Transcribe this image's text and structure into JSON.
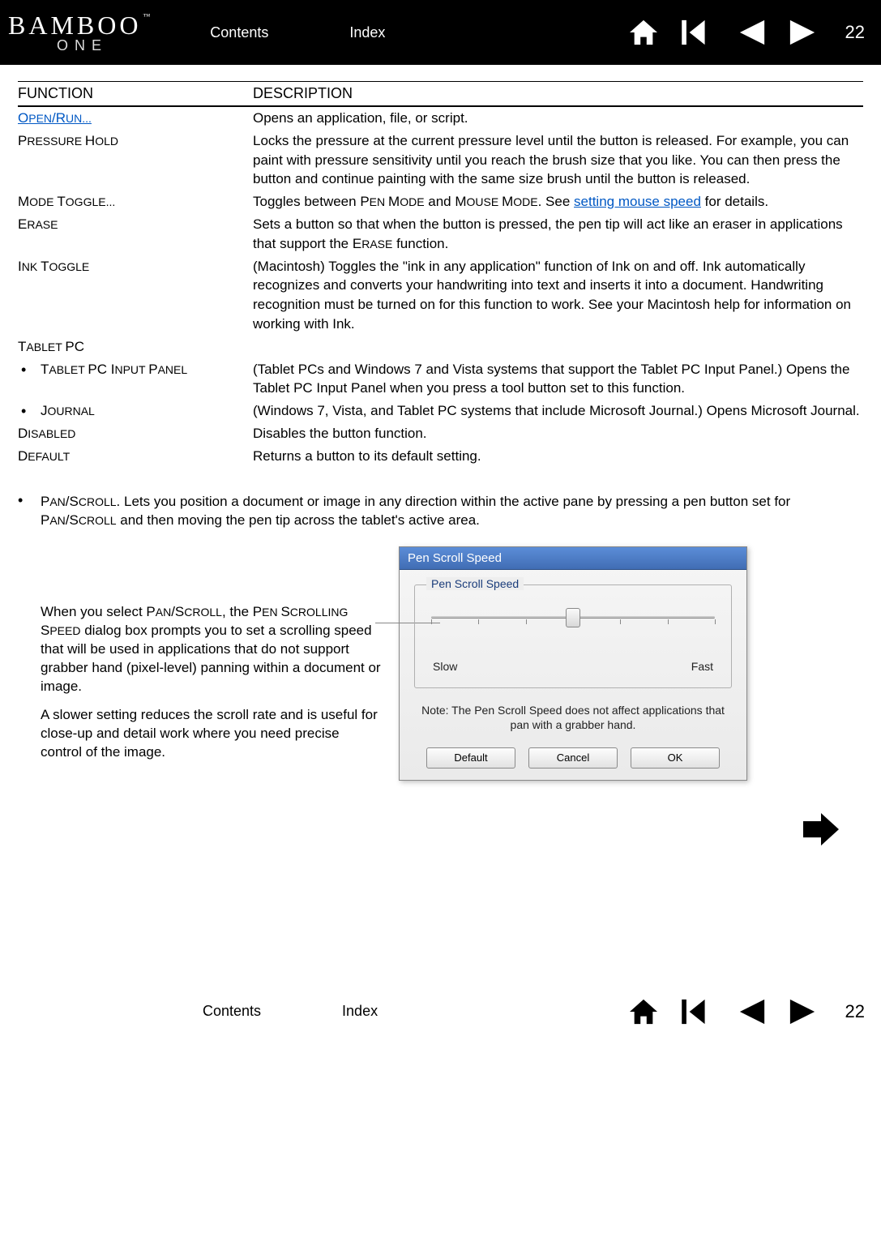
{
  "brand": {
    "main": "BAMBOO",
    "tm": "™",
    "sub": "ONE"
  },
  "nav": {
    "contents": "Contents",
    "index_": "Index"
  },
  "page_number": "22",
  "table": {
    "header_function": "FUNCTION",
    "header_description": "DESCRIPTION",
    "rows": {
      "open_run": {
        "fn_pre": "O",
        "fn_rest": "PEN",
        "fn_sep": "/R",
        "fn_rest2": "UN...",
        "desc": "Opens an application, file, or script."
      },
      "pressure_hold": {
        "fn_pre": "P",
        "fn_rest": "RESSURE ",
        "fn_pre2": "H",
        "fn_rest2": "OLD",
        "desc": "Locks the pressure at the current pressure level until the button is released.  For example, you can paint with pressure sensitivity until you reach the brush size that you like.  You can then press the button and continue painting with the same size brush until the button is released."
      },
      "mode_toggle": {
        "fn_pre": "M",
        "fn_rest": "ODE ",
        "fn_pre2": "T",
        "fn_rest2": "OGGLE...",
        "desc_before": "Toggles between ",
        "desc_sc1_pre": "P",
        "desc_sc1_rest": "EN ",
        "desc_sc1b_pre": "M",
        "desc_sc1b_rest": "ODE",
        "desc_mid": " and ",
        "desc_sc2_pre": "M",
        "desc_sc2_rest": "OUSE ",
        "desc_sc2b_pre": "M",
        "desc_sc2b_rest": "ODE",
        "desc_after1": ".  See ",
        "desc_link": "setting mouse speed",
        "desc_after2": " for details."
      },
      "erase": {
        "fn_pre": "E",
        "fn_rest": "RASE",
        "desc_before": "Sets a button so that when the button is pressed, the pen tip will act like an eraser in applications that support the ",
        "desc_sc_pre": "E",
        "desc_sc_rest": "RASE",
        "desc_after": " function."
      },
      "ink_toggle": {
        "fn_pre": "I",
        "fn_rest": "NK ",
        "fn_pre2": "T",
        "fn_rest2": "OGGLE",
        "desc": "(Macintosh)  Toggles the \"ink in any application\" function of Ink on and off.  Ink automatically recognizes and converts your handwriting into text and inserts it into a document.  Handwriting recognition must be turned on for this function to work.  See your Macintosh help for information on working with Ink."
      },
      "tablet_pc": {
        "fn_pre": "T",
        "fn_rest": "ABLET ",
        "fn_pc": "PC"
      },
      "tablet_panel": {
        "fn_pre": "T",
        "fn_rest": "ABLET ",
        "fn_pc": "PC ",
        "fn_pre2": "I",
        "fn_rest2": "NPUT ",
        "fn_pre3": "P",
        "fn_rest3": "ANEL",
        "desc": "(Tablet PCs and Windows 7 and Vista systems that support the Tablet PC Input Panel.)  Opens the Tablet PC Input Panel when you press a tool button set to this function."
      },
      "journal": {
        "fn_pre": "J",
        "fn_rest": "OURNAL",
        "desc": "(Windows 7, Vista, and Tablet PC systems that include Microsoft Journal.)  Opens Microsoft Journal."
      },
      "disabled": {
        "fn_pre": "D",
        "fn_rest": "ISABLED",
        "desc": "Disables the button function."
      },
      "default_": {
        "fn_pre": "D",
        "fn_rest": "EFAULT",
        "desc": "Returns a button to its default setting."
      }
    }
  },
  "pan": {
    "sc_pre": "P",
    "sc_rest": "AN",
    "sc_sep": "/S",
    "sc_rest2": "CROLL",
    "text_before": ".  Lets you position a document or image in any direction within the active pane by pressing a pen button set for ",
    "text_after": " and then moving the pen tip across the tablet's active area."
  },
  "desc_para": {
    "p1_before": "When you select ",
    "p1_sc1_pre": "P",
    "p1_sc1_rest": "AN",
    "p1_sc1_sep": "/S",
    "p1_sc1_rest2": "CROLL",
    "p1_mid": ", the ",
    "p1_sc2_pre": "P",
    "p1_sc2_rest": "EN ",
    "p1_sc2b_pre": "S",
    "p1_sc2b_rest": "CROLLING ",
    "p1_sc2c_pre": "S",
    "p1_sc2c_rest": "PEED",
    "p1_after": " dialog box prompts you to set a scrolling speed that will be used in applications that do not support grabber hand (pixel-level) panning within a document or image.",
    "p2": "A slower setting reduces the scroll rate and is useful for close-up and detail work where you need precise control of the image."
  },
  "dialog": {
    "title": "Pen Scroll Speed",
    "legend": "Pen Scroll Speed",
    "slow": "Slow",
    "fast": "Fast",
    "note": "Note: The Pen Scroll Speed does not affect applications that pan with a grabber hand.",
    "btn_default": "Default",
    "btn_cancel": "Cancel",
    "btn_ok": "OK"
  }
}
